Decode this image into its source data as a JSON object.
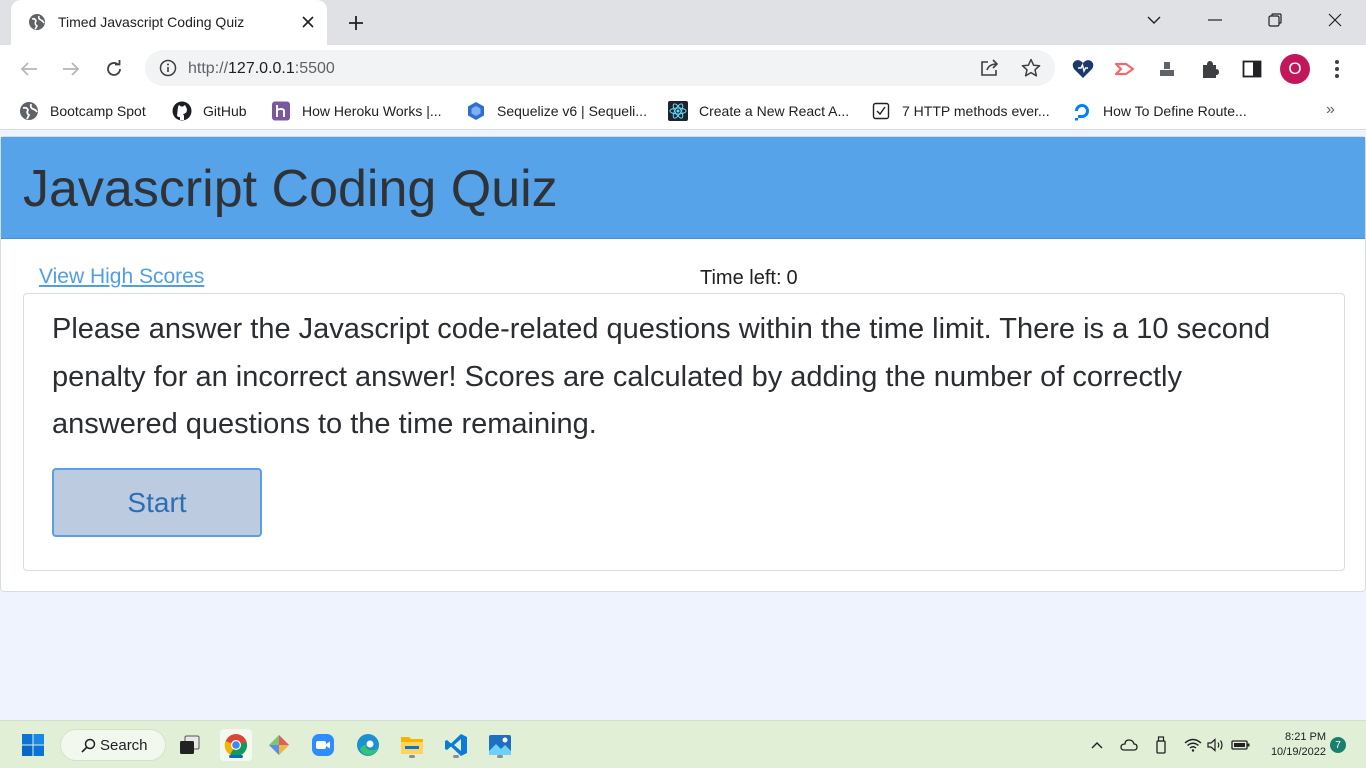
{
  "browser": {
    "tab_title": "Timed Javascript Coding Quiz",
    "url_scheme": "http://",
    "url_host": "127.0.0.1",
    "url_rest": ":5500",
    "profile_initial": "O"
  },
  "bookmarks": [
    {
      "label": "Bootcamp Spot",
      "icon": "globe-icon"
    },
    {
      "label": "GitHub",
      "icon": "github-icon"
    },
    {
      "label": "How Heroku Works |...",
      "icon": "heroku-icon"
    },
    {
      "label": "Sequelize v6 | Sequeli...",
      "icon": "sequelize-icon"
    },
    {
      "label": "Create a New React A...",
      "icon": "react-icon"
    },
    {
      "label": "7 HTTP methods ever...",
      "icon": "checkbox-icon"
    },
    {
      "label": "How To Define Route...",
      "icon": "digitalocean-icon"
    }
  ],
  "page": {
    "title": "Javascript Coding Quiz",
    "high_scores_link": "View High Scores",
    "timer_label": "Time left:",
    "timer_value": "0",
    "intro_text": "Please answer the Javascript code-related questions within the time limit. There is a 10 second penalty for an incorrect answer! Scores are calculated by adding the number of correctly answered questions to the time remaining.",
    "start_button": "Start"
  },
  "taskbar": {
    "search_label": "Search",
    "time": "8:21 PM",
    "date": "10/19/2022",
    "notification_count": "7"
  },
  "colors": {
    "header": "#56a3e9",
    "link": "#4f9ee6",
    "start_button_bg": "#bccbe0",
    "page_bg": "#eef3fd"
  }
}
